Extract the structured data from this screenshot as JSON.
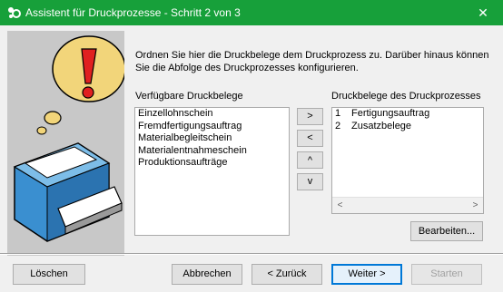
{
  "window": {
    "title": "Assistent für Druckprozesse - Schritt 2 von 3",
    "close_glyph": "✕"
  },
  "intro_text": "Ordnen Sie hier die Druckbelege dem Druckprozess zu. Darüber hinaus können Sie die Abfolge des Druckprozesses konfigurieren.",
  "available": {
    "label": "Verfügbare Druckbelege",
    "items": [
      "Einzellohnschein",
      "Fremdfertigungsauftrag",
      "Materialbegleitschein",
      "Materialentnahmeschein",
      "Produktionsaufträge"
    ]
  },
  "process": {
    "label": "Druckbelege des Druckprozesses",
    "items": [
      {
        "num": "1",
        "name": "Fertigungsauftrag"
      },
      {
        "num": "2",
        "name": "Zusatzbelege"
      }
    ],
    "scroll_left": "<",
    "scroll_right": ">"
  },
  "move_buttons": {
    "add": ">",
    "remove": "<",
    "up": "^",
    "down": "v"
  },
  "edit_button": "Bearbeiten...",
  "footer": {
    "delete": "Löschen",
    "cancel": "Abbrechen",
    "back": "< Zurück",
    "next": "Weiter >",
    "start": "Starten"
  },
  "colors": {
    "titlebar": "#17a03a",
    "accent_red": "#e02020",
    "bubble_yellow": "#f2d57a",
    "printer_blue": "#3a8fd0"
  }
}
